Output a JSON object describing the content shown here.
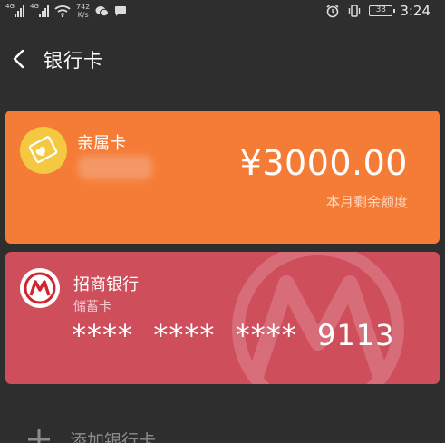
{
  "status_bar": {
    "signal1_label": "4G",
    "signal2_label": "4G",
    "speed_value": "742",
    "speed_unit": "K/s",
    "battery": "33",
    "time": "3:24"
  },
  "header": {
    "title": "银行卡"
  },
  "cards": {
    "family": {
      "name": "亲属卡",
      "amount": "¥3000.00",
      "amount_label": "本月剩余额度",
      "color": "#f57c36"
    },
    "bank": {
      "name": "招商银行",
      "type": "储蓄卡",
      "number": "****  ****  ****  9113",
      "color": "#cf4e5c"
    }
  },
  "add_card": {
    "label": "添加银行卡"
  }
}
